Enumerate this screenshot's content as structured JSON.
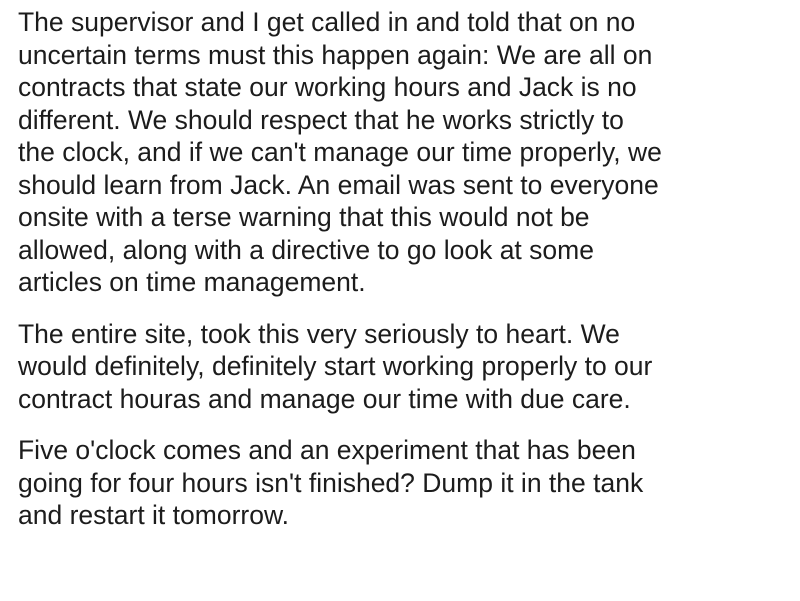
{
  "post": {
    "paragraphs": [
      {
        "lines": [
          "The supervisor and I get called in and told that on no",
          "uncertain terms must this happen again: We are all on",
          "contracts that state our working hours and Jack is no",
          "different. We should respect that he works strictly to",
          "the clock, and if we can't manage our time properly, we",
          "should learn from Jack. An email was sent to everyone",
          "onsite with a terse warning that this would not be",
          "allowed, along with a directive to go look at some",
          "articles on time management."
        ]
      },
      {
        "lines": [
          "The entire site, took this very seriously to heart. We",
          "would definitely, definitely start working properly to our",
          "contract houras and manage our time with due care."
        ]
      },
      {
        "lines": [
          "Five o'clock comes and an experiment that has been",
          "going for four hours isn't finished? Dump it in the tank",
          "and restart it tomorrow."
        ]
      }
    ]
  }
}
